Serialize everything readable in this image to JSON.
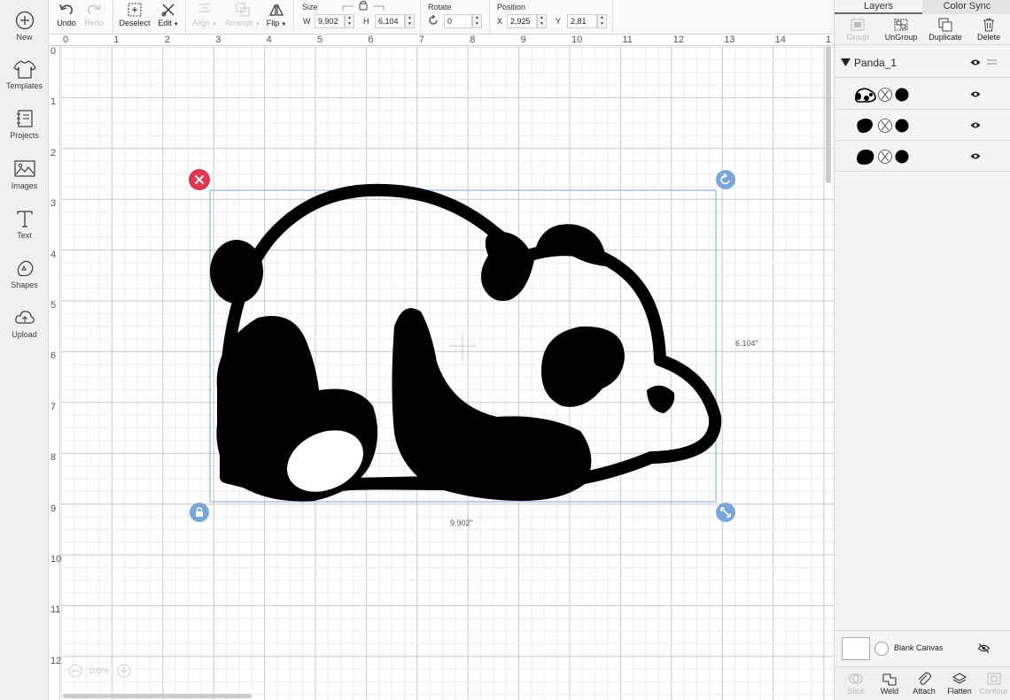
{
  "sidebar": {
    "items": [
      {
        "label": "New",
        "icon": "plus-circle-icon"
      },
      {
        "label": "Templates",
        "icon": "tshirt-icon"
      },
      {
        "label": "Projects",
        "icon": "notebook-icon"
      },
      {
        "label": "Images",
        "icon": "image-icon"
      },
      {
        "label": "Text",
        "icon": "text-t-icon"
      },
      {
        "label": "Shapes",
        "icon": "shapes-icon"
      },
      {
        "label": "Upload",
        "icon": "cloud-upload-icon"
      }
    ]
  },
  "toolbar": {
    "undo_label": "Undo",
    "redo_label": "Redo",
    "deselect_label": "Deselect",
    "edit_label": "Edit",
    "align_label": "Align",
    "arrange_label": "Arrange",
    "flip_label": "Flip",
    "size_label": "Size",
    "w_label": "W",
    "w_value": "9,902",
    "h_label": "H",
    "h_value": "6,104",
    "rotate_label": "Rotate",
    "rotate_value": "0",
    "position_label": "Position",
    "x_label": "X",
    "x_value": "2,925",
    "y_label": "Y",
    "y_value": "2,81"
  },
  "canvas": {
    "ruler_top": [
      "0",
      "1",
      "2",
      "3",
      "4",
      "5",
      "6",
      "7",
      "8",
      "9",
      "10",
      "11",
      "12",
      "13",
      "14",
      "1"
    ],
    "ruler_left": [
      "0",
      "1",
      "2",
      "3",
      "4",
      "5",
      "6",
      "7",
      "8",
      "9",
      "10",
      "11",
      "12"
    ],
    "width_label": "9.902\"",
    "height_label": "6.104\"",
    "zoom_value": "100%"
  },
  "layers_panel": {
    "tabs": [
      "Layers",
      "Color Sync"
    ],
    "actions": [
      "Group",
      "UnGroup",
      "Duplicate",
      "Delete"
    ],
    "group_name": "Panda_1",
    "blank_canvas_label": "Blank Canvas",
    "bottom_actions": [
      "Slice",
      "Weld",
      "Attach",
      "Flatten",
      "Contour"
    ]
  },
  "colors": {
    "accent": "#6b9bd1",
    "delete_handle": "#e0394f",
    "shape_fill": "#000000",
    "grid_line": "#dcdcdc"
  }
}
